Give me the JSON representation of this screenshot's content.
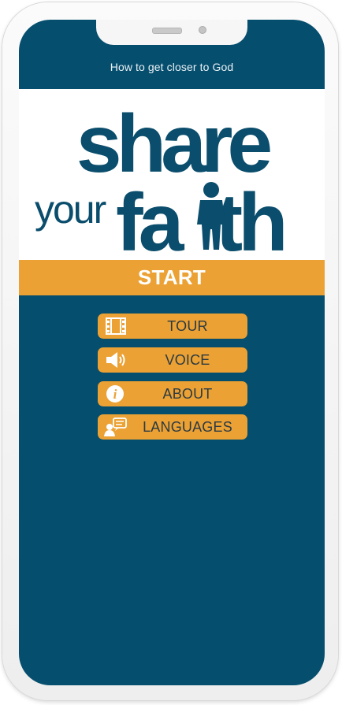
{
  "header": {
    "subtitle": "How to get closer to God"
  },
  "logo": {
    "word1": "share",
    "word2": "your",
    "word3": "faith",
    "alt": "share your faith"
  },
  "start": {
    "label": "START"
  },
  "menu": [
    {
      "label": "TOUR",
      "icon": "film-icon"
    },
    {
      "label": "VOICE",
      "icon": "speaker-icon"
    },
    {
      "label": "ABOUT",
      "icon": "info-icon"
    },
    {
      "label": "LANGUAGES",
      "icon": "person-speech-icon"
    }
  ],
  "colors": {
    "screen_bg": "#064e6e",
    "accent_orange": "#eba133",
    "logo_blue": "#0a4d6c",
    "white": "#ffffff"
  }
}
